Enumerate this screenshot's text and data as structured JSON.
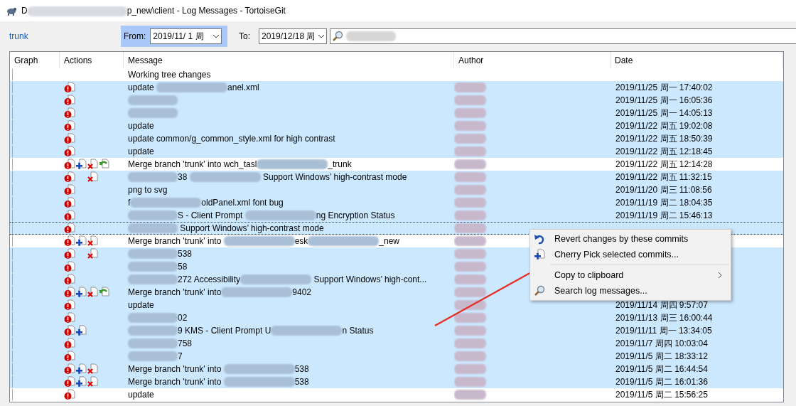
{
  "window": {
    "title": [
      {
        "kind": "text",
        "text": "D"
      },
      {
        "kind": "blur"
      },
      {
        "kind": "text",
        "text": "p_new\\client - Log Messages - TortoiseGit"
      }
    ]
  },
  "toolbar": {
    "branch": "trunk",
    "from_label": "From:",
    "from_value": "2019/11/  1 周",
    "from_active": true,
    "to_label": "To:",
    "to_value": "2019/12/18 周",
    "search": [
      {
        "kind": "blur"
      }
    ]
  },
  "table": {
    "columns": [
      "Graph",
      "Actions",
      "Message",
      "Author",
      "Date"
    ],
    "rows": [
      {
        "selected": false,
        "focused": false,
        "actions": [],
        "message": [
          {
            "kind": "text",
            "text": "Working tree changes"
          }
        ]
      },
      {
        "selected": true,
        "focused": false,
        "actions": [
          {
            "kind": "conflict"
          }
        ],
        "message": [
          {
            "kind": "text",
            "text": "update "
          },
          {
            "kind": "blur"
          },
          {
            "kind": "text",
            "text": "anel.xml"
          }
        ],
        "author": [
          {
            "kind": "blur"
          }
        ],
        "date": "2019/11/25 周一 17:40:02"
      },
      {
        "selected": true,
        "focused": false,
        "actions": [
          {
            "kind": "conflict"
          }
        ],
        "message": [
          {
            "kind": "blur"
          }
        ],
        "author": [
          {
            "kind": "blur"
          }
        ],
        "date": "2019/11/25 周一 16:05:36"
      },
      {
        "selected": true,
        "focused": false,
        "actions": [
          {
            "kind": "conflict"
          }
        ],
        "message": [
          {
            "kind": "blur"
          }
        ],
        "author": [
          {
            "kind": "blur"
          }
        ],
        "date": "2019/11/25 周一 14:05:13"
      },
      {
        "selected": true,
        "focused": false,
        "actions": [
          {
            "kind": "conflict"
          }
        ],
        "message": [
          {
            "kind": "text",
            "text": "update"
          }
        ],
        "author": [
          {
            "kind": "blur"
          }
        ],
        "date": "2019/11/22 周五 19:02:08"
      },
      {
        "selected": true,
        "focused": false,
        "actions": [
          {
            "kind": "conflict"
          }
        ],
        "message": [
          {
            "kind": "text",
            "text": "update common/g_common_style.xml for high contrast"
          }
        ],
        "author": [
          {
            "kind": "blur"
          }
        ],
        "date": "2019/11/22 周五 18:50:39"
      },
      {
        "selected": true,
        "focused": false,
        "actions": [
          {
            "kind": "conflict"
          }
        ],
        "message": [
          {
            "kind": "text",
            "text": "update"
          }
        ],
        "author": [
          {
            "kind": "blur"
          }
        ],
        "date": "2019/11/22 周五 12:18:45"
      },
      {
        "selected": false,
        "focused": false,
        "actions": [
          {
            "kind": "conflict"
          },
          {
            "kind": "add"
          },
          {
            "kind": "delete"
          },
          {
            "kind": "revert"
          }
        ],
        "message": [
          {
            "kind": "text",
            "text": "Merge branch 'trunk' into wch_tasl"
          },
          {
            "kind": "blur"
          },
          {
            "kind": "text",
            "text": "_trunk"
          }
        ],
        "author": [
          {
            "kind": "blur"
          }
        ],
        "date": "2019/11/22 周五 12:14:28"
      },
      {
        "selected": true,
        "focused": false,
        "actions": [
          {
            "kind": "conflict"
          },
          {
            "kind": "delete"
          }
        ],
        "message": [
          {
            "kind": "blur"
          },
          {
            "kind": "text",
            "text": "38 "
          },
          {
            "kind": "blur"
          },
          {
            "kind": "text",
            "text": " Support Windows’ high-contrast mode"
          }
        ],
        "author": [
          {
            "kind": "blur"
          }
        ],
        "date": "2019/11/22 周五 11:32:15"
      },
      {
        "selected": true,
        "focused": false,
        "actions": [
          {
            "kind": "conflict"
          }
        ],
        "message": [
          {
            "kind": "text",
            "text": "png to svg"
          }
        ],
        "author": [
          {
            "kind": "blur"
          }
        ],
        "date": "2019/11/20 周三 11:08:56"
      },
      {
        "selected": true,
        "focused": false,
        "actions": [
          {
            "kind": "conflict"
          }
        ],
        "message": [
          {
            "kind": "text",
            "text": "f"
          },
          {
            "kind": "blur"
          },
          {
            "kind": "text",
            "text": "oldPanel.xml font bug"
          }
        ],
        "author": [
          {
            "kind": "blur"
          }
        ],
        "date": "2019/11/19 周二 18:04:35"
      },
      {
        "selected": true,
        "focused": false,
        "actions": [
          {
            "kind": "conflict"
          }
        ],
        "message": [
          {
            "kind": "blur"
          },
          {
            "kind": "text",
            "text": "S - Client Prompt "
          },
          {
            "kind": "blur"
          },
          {
            "kind": "text",
            "text": "ng Encryption Status"
          }
        ],
        "author": [
          {
            "kind": "blur"
          }
        ],
        "date": "2019/11/19 周二 15:46:13"
      },
      {
        "selected": true,
        "focused": true,
        "actions": [
          {
            "kind": "conflict"
          }
        ],
        "message": [
          {
            "kind": "blur"
          },
          {
            "kind": "text",
            "text": " Support Windows’ high-contrast mode"
          }
        ],
        "author": [
          {
            "kind": "blur"
          }
        ]
      },
      {
        "selected": false,
        "focused": false,
        "actions": [
          {
            "kind": "conflict"
          },
          {
            "kind": "add"
          },
          {
            "kind": "delete"
          }
        ],
        "message": [
          {
            "kind": "text",
            "text": "Merge branch 'trunk' into "
          },
          {
            "kind": "blur"
          },
          {
            "kind": "text",
            "text": "esk"
          },
          {
            "kind": "blur"
          },
          {
            "kind": "text",
            "text": "_new"
          }
        ],
        "author": [
          {
            "kind": "blur"
          }
        ]
      },
      {
        "selected": true,
        "focused": false,
        "actions": [
          {
            "kind": "conflict"
          },
          {
            "kind": "delete"
          }
        ],
        "message": [
          {
            "kind": "blur"
          },
          {
            "kind": "text",
            "text": "538"
          }
        ],
        "author": [
          {
            "kind": "blur"
          }
        ]
      },
      {
        "selected": true,
        "focused": false,
        "actions": [
          {
            "kind": "conflict"
          }
        ],
        "message": [
          {
            "kind": "blur"
          },
          {
            "kind": "text",
            "text": "58"
          }
        ],
        "author": [
          {
            "kind": "blur"
          }
        ]
      },
      {
        "selected": true,
        "focused": false,
        "actions": [
          {
            "kind": "conflict"
          }
        ],
        "message": [
          {
            "kind": "blur"
          },
          {
            "kind": "text",
            "text": "272 Accessibility"
          },
          {
            "kind": "blur"
          },
          {
            "kind": "text",
            "text": " Support Windows’ high-cont..."
          }
        ],
        "author": [
          {
            "kind": "blur"
          }
        ]
      },
      {
        "selected": true,
        "focused": false,
        "actions": [
          {
            "kind": "conflict"
          },
          {
            "kind": "add"
          },
          {
            "kind": "delete"
          },
          {
            "kind": "revert"
          }
        ],
        "message": [
          {
            "kind": "text",
            "text": "Merge branch 'trunk' into"
          },
          {
            "kind": "blur"
          },
          {
            "kind": "text",
            "text": "9402"
          }
        ],
        "author": [
          {
            "kind": "blur"
          }
        ]
      },
      {
        "selected": true,
        "focused": false,
        "actions": [
          {
            "kind": "conflict"
          }
        ],
        "message": [
          {
            "kind": "text",
            "text": "update"
          }
        ],
        "author": [
          {
            "kind": "blur"
          }
        ],
        "date": "2019/11/14 周四 9:57:07"
      },
      {
        "selected": true,
        "focused": false,
        "actions": [
          {
            "kind": "conflict"
          }
        ],
        "message": [
          {
            "kind": "blur"
          },
          {
            "kind": "text",
            "text": "02"
          }
        ],
        "author": [
          {
            "kind": "blur"
          }
        ],
        "date": "2019/11/13 周三 16:00:44"
      },
      {
        "selected": true,
        "focused": false,
        "actions": [
          {
            "kind": "conflict"
          },
          {
            "kind": "add"
          }
        ],
        "message": [
          {
            "kind": "blur"
          },
          {
            "kind": "text",
            "text": "9 KMS - Client Prompt U"
          },
          {
            "kind": "blur"
          },
          {
            "kind": "text",
            "text": "n Status"
          }
        ],
        "author": [
          {
            "kind": "blur"
          }
        ],
        "date": "2019/11/11 周一 13:34:05"
      },
      {
        "selected": true,
        "focused": false,
        "actions": [
          {
            "kind": "conflict"
          }
        ],
        "message": [
          {
            "kind": "blur"
          },
          {
            "kind": "text",
            "text": "758"
          }
        ],
        "author": [
          {
            "kind": "blur"
          }
        ],
        "date": "2019/11/7 周四 10:03:04"
      },
      {
        "selected": true,
        "focused": false,
        "actions": [
          {
            "kind": "conflict"
          }
        ],
        "message": [
          {
            "kind": "blur"
          },
          {
            "kind": "text",
            "text": "7"
          }
        ],
        "author": [
          {
            "kind": "blur"
          }
        ],
        "date": "2019/11/5 周二 18:33:12"
      },
      {
        "selected": true,
        "focused": false,
        "actions": [
          {
            "kind": "conflict"
          },
          {
            "kind": "add"
          },
          {
            "kind": "delete"
          }
        ],
        "message": [
          {
            "kind": "text",
            "text": "Merge branch 'trunk' into "
          },
          {
            "kind": "blur"
          },
          {
            "kind": "text",
            "text": "538"
          }
        ],
        "author": [
          {
            "kind": "blur"
          }
        ],
        "date": "2019/11/5 周二 16:44:54"
      },
      {
        "selected": true,
        "focused": false,
        "actions": [
          {
            "kind": "conflict"
          },
          {
            "kind": "add"
          },
          {
            "kind": "delete"
          }
        ],
        "message": [
          {
            "kind": "text",
            "text": "Merge branch 'trunk' into "
          },
          {
            "kind": "blur"
          },
          {
            "kind": "text",
            "text": "538"
          }
        ],
        "author": [
          {
            "kind": "blur"
          }
        ],
        "date": "2019/11/5 周二 16:01:36"
      },
      {
        "selected": false,
        "focused": false,
        "actions": [
          {
            "kind": "conflict"
          }
        ],
        "message": [
          {
            "kind": "text",
            "text": "update"
          }
        ],
        "author": [
          {
            "kind": "blur"
          }
        ],
        "date": "2019/11/5 周二 15:56:25"
      }
    ]
  },
  "context_menu": {
    "items": [
      {
        "kind": "item",
        "label": "Revert changes by these commits",
        "submenu": false
      },
      {
        "kind": "item",
        "label": "Cherry Pick selected commits...",
        "submenu": false
      },
      {
        "kind": "separator"
      },
      {
        "kind": "item",
        "label": "Copy to clipboard",
        "submenu": true
      },
      {
        "kind": "item",
        "label": "Search log messages...",
        "submenu": false
      }
    ]
  }
}
